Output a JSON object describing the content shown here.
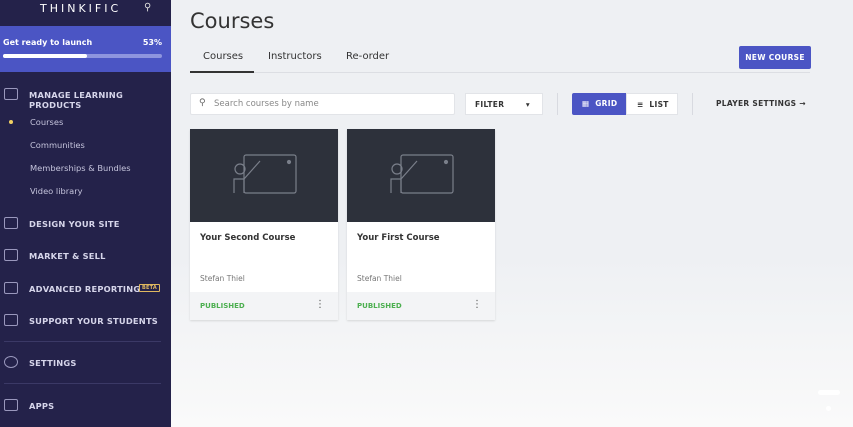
{
  "sidebar": {
    "logo": "THINKIFIC",
    "launch": {
      "title": "Get ready to launch",
      "percent_label": "53%",
      "progress": 53
    },
    "sections": [
      {
        "label": "MANAGE LEARNING PRODUCTS",
        "icon": "edit-icon"
      },
      {
        "label": "DESIGN YOUR SITE",
        "icon": "layout-icon"
      },
      {
        "label": "MARKET & SELL",
        "icon": "presentation-icon"
      },
      {
        "label": "ADVANCED REPORTING",
        "icon": "report-icon",
        "badge": "BETA"
      },
      {
        "label": "SUPPORT YOUR STUDENTS",
        "icon": "users-icon"
      },
      {
        "label": "SETTINGS",
        "icon": "gear-icon"
      },
      {
        "label": "APPS",
        "icon": "plug-icon"
      }
    ],
    "sub_items": [
      {
        "label": "Courses",
        "active": true
      },
      {
        "label": "Communities"
      },
      {
        "label": "Memberships & Bundles"
      },
      {
        "label": "Video library"
      }
    ]
  },
  "header": {
    "title": "Courses",
    "tabs": [
      {
        "label": "Courses",
        "active": true
      },
      {
        "label": "Instructors"
      },
      {
        "label": "Re-order"
      }
    ],
    "new_course": "NEW COURSE"
  },
  "toolbar": {
    "search_placeholder": "Search courses by name",
    "filter": "FILTER",
    "grid": "GRID",
    "list": "LIST",
    "player_settings": "PLAYER SETTINGS"
  },
  "courses": [
    {
      "title": "Your Second Course",
      "author": "Stefan Thiel",
      "status": "PUBLISHED"
    },
    {
      "title": "Your First Course",
      "author": "Stefan Thiel",
      "status": "PUBLISHED"
    }
  ],
  "colors": {
    "sidebar": "#24224a",
    "accent": "#4b55c4",
    "published": "#4caf50"
  }
}
